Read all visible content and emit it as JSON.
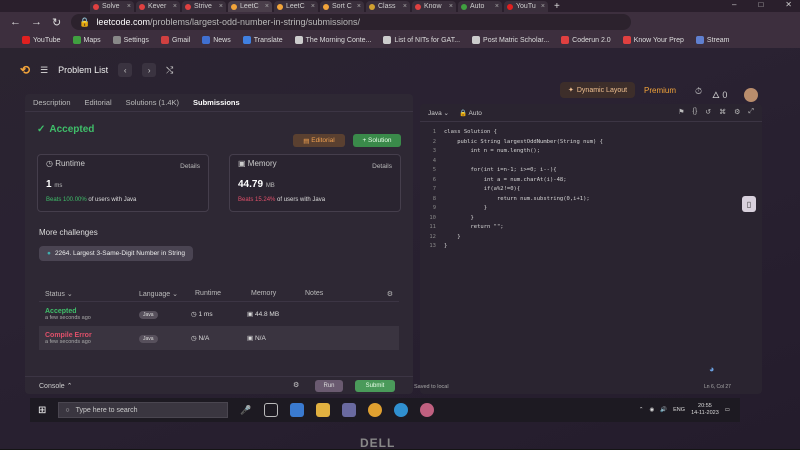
{
  "browser": {
    "tabs": [
      {
        "label": "Solve",
        "color": "#e04040"
      },
      {
        "label": "Kever",
        "color": "#e04040"
      },
      {
        "label": "Strive",
        "color": "#e04040"
      },
      {
        "label": "LeetC",
        "color": "#f2a43a"
      },
      {
        "label": "LeetC",
        "color": "#f2a43a"
      },
      {
        "label": "Sort C",
        "color": "#f2a43a"
      },
      {
        "label": "Class",
        "color": "#d0a030"
      },
      {
        "label": "Know",
        "color": "#e04040"
      },
      {
        "label": "Auto",
        "color": "#40a040"
      },
      {
        "label": "YouTu",
        "color": "#e02020"
      }
    ],
    "url_host": "leetcode.com",
    "url_path": "/problems/largest-odd-number-in-string/submissions/",
    "bookmarks": [
      "YouTube",
      "Maps",
      "Settings",
      "Gmail",
      "News",
      "Translate",
      "The Morning Conte...",
      "List of NITs for GAT...",
      "Post Matric Scholar...",
      "Coderun 2.0",
      "Know Your Prep",
      "Stream"
    ]
  },
  "header": {
    "problem_list": "Problem List",
    "dynamic_layout": "Dynamic Layout",
    "premium": "Premium",
    "streak": "0"
  },
  "left": {
    "tabs": [
      "Description",
      "Editorial",
      "Solutions (1.4K)",
      "Submissions"
    ],
    "status": "Accepted",
    "editorial_btn": "Editorial",
    "solution_btn": "+ Solution",
    "runtime": {
      "label": "Runtime",
      "details": "Details",
      "value": "1",
      "unit": "ms",
      "beats_pct": "Beats 100.00%",
      "beats_rest": " of users with Java"
    },
    "memory": {
      "label": "Memory",
      "details": "Details",
      "value": "44.79",
      "unit": "MB",
      "beats_pct": "Beats 15.24%",
      "beats_rest": " of users with Java"
    },
    "more_challenges": "More challenges",
    "challenge": "2264. Largest 3-Same-Digit Number in String",
    "table_headers": [
      "Status",
      "Language",
      "Runtime",
      "Memory",
      "Notes"
    ],
    "rows": [
      {
        "status": "Accepted",
        "when": "a few seconds ago",
        "lang": "Java",
        "runtime": "1 ms",
        "memory": "44.8 MB",
        "color": "#3fbf6a"
      },
      {
        "status": "Compile Error",
        "when": "a few seconds ago",
        "lang": "Java",
        "runtime": "N/A",
        "memory": "N/A",
        "color": "#e0506a"
      }
    ],
    "console": "Console",
    "run": "Run",
    "submit": "Submit"
  },
  "editor": {
    "language": "Java",
    "auto": "Auto",
    "lines": [
      "class Solution {",
      "    public String largestOddNumber(String num) {",
      "        int n = num.length();",
      "",
      "        for(int i=n-1; i>=0; i--){",
      "            int a = num.charAt(i)-48;",
      "            if(a%2!=0){",
      "                return num.substring(0,i+1);",
      "            }",
      "        }",
      "        return \"\";",
      "    }",
      "}"
    ],
    "saved": "Saved to local",
    "cursor": "Ln 6, Col 27"
  },
  "taskbar": {
    "search_placeholder": "Type here to search",
    "lang": "ENG",
    "time": "20:55",
    "date": "14-11-2023"
  }
}
